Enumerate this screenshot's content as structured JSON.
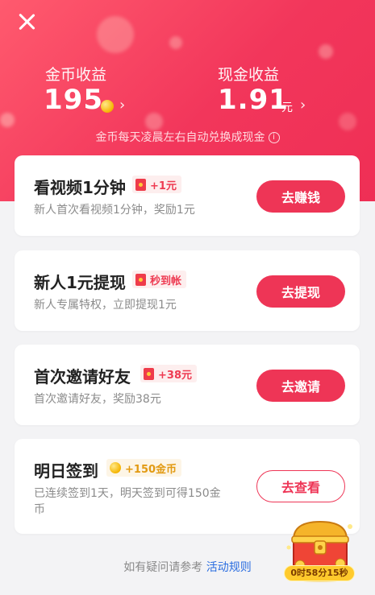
{
  "header": {
    "close_icon": "close-icon",
    "coins": {
      "label": "金币收益",
      "value": "195"
    },
    "cash": {
      "label": "现金收益",
      "value": "1.91",
      "unit": "元"
    },
    "notice": "金币每天凌晨左右自动兑换成现金"
  },
  "tasks": [
    {
      "title": "看视频1分钟",
      "badge": "+1元",
      "desc": "新人首次看视频1分钟，奖励1元",
      "button": "去赚钱"
    },
    {
      "title": "新人1元提现",
      "badge": "秒到帐",
      "desc": "新人专属特权，立即提现1元",
      "button": "去提现"
    },
    {
      "title": "首次邀请好友",
      "badge": "+38元",
      "desc": "首次邀请好友，奖励38元",
      "button": "去邀请"
    },
    {
      "title": "明日签到",
      "badge": "+150金币",
      "desc_line1": "已连续签到1天，明天签到可得150金",
      "desc_line2": "币",
      "button": "去查看"
    }
  ],
  "footer": {
    "text": "如有疑问请参考 ",
    "link": "活动规则"
  },
  "chest": {
    "timer": "0时58分15秒"
  },
  "colors": {
    "accent": "#ee3556",
    "header": "#f2365b",
    "link": "#2a6de0"
  }
}
